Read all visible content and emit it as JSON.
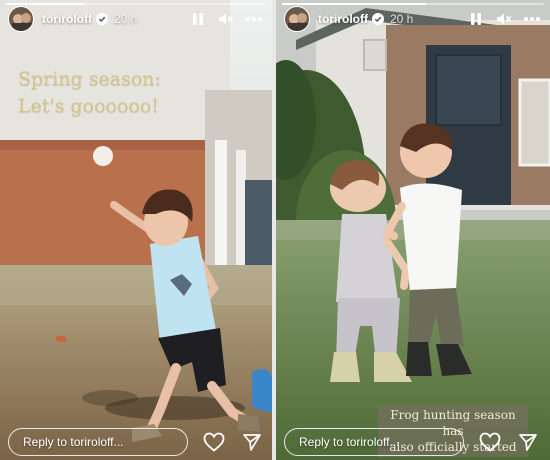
{
  "stories": [
    {
      "username": "toriroloff",
      "time_ago": "20 h",
      "progress": 0.3,
      "caption": [
        "Spring season:",
        "Let's goooooo!"
      ],
      "reply_placeholder": "Reply to toriroloff..."
    },
    {
      "username": "toriroloff",
      "time_ago": "20 h",
      "progress": 0.55,
      "caption": [
        "Frog hunting season has",
        "also officially started"
      ],
      "reply_placeholder": "Reply to toriroloff..."
    }
  ],
  "icons": {
    "pause": "pause-icon",
    "mute": "speaker-muted-icon",
    "more": "more-icon",
    "like": "heart-icon",
    "share": "send-icon",
    "verified": "verified-badge-icon"
  },
  "colors": {
    "caption_gold": "#d7c48a",
    "verified_blue": "#3897f0",
    "white": "#ffffff"
  }
}
